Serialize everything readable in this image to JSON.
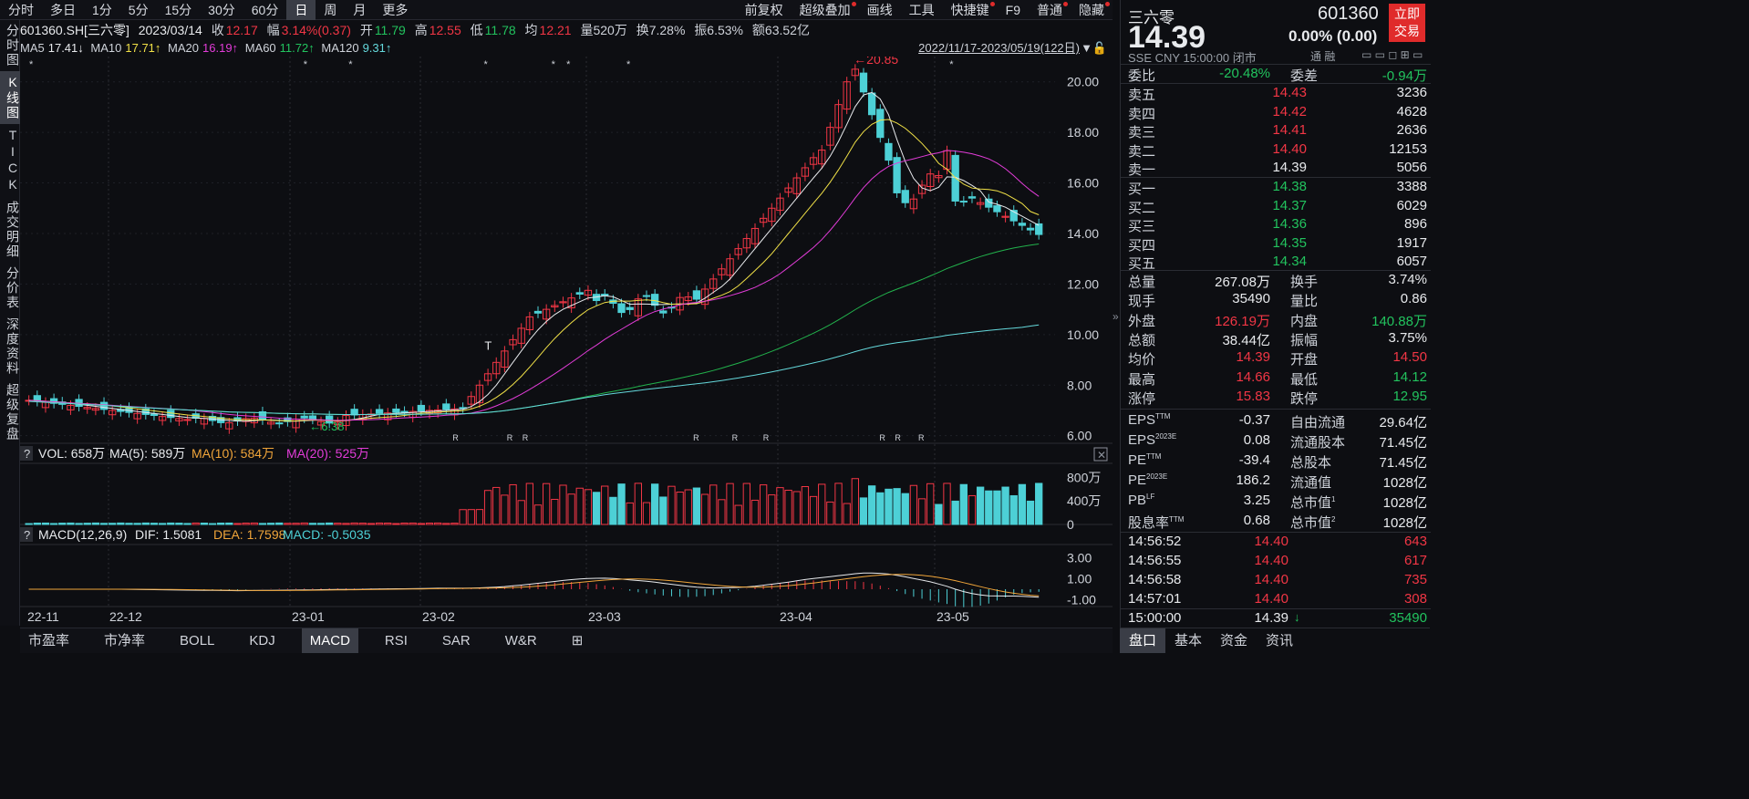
{
  "top_tabs": [
    "分时",
    "多日",
    "1分",
    "5分",
    "15分",
    "30分",
    "60分",
    "日",
    "周",
    "月",
    "更多"
  ],
  "active_tab": "日",
  "top_tools": [
    {
      "label": "前复权",
      "dot": false
    },
    {
      "label": "超级叠加",
      "dot": true
    },
    {
      "label": "画线",
      "dot": false
    },
    {
      "label": "工具",
      "dot": false
    },
    {
      "label": "快捷键",
      "dot": true
    },
    {
      "label": "F9",
      "dot": false
    },
    {
      "label": "普通",
      "dot": true
    },
    {
      "label": "隐藏",
      "dot": true
    }
  ],
  "left_nav": [
    "分时图",
    "K线图",
    "TICK",
    "成交明细",
    "分价表",
    "深度资料",
    "超级复盘"
  ],
  "info": {
    "code": "601360.SH[三六零]",
    "date": "2023/03/14",
    "close_label": "收",
    "close": "12.17",
    "chg_label": "幅",
    "chg": "3.14%(0.37)",
    "open_label": "开",
    "open": "11.79",
    "high_label": "高",
    "high": "12.55",
    "low_label": "低",
    "low": "11.78",
    "avg_label": "均",
    "avg": "12.21",
    "vol": "量520万",
    "turnover": "换7.28%",
    "amp": "振6.53%",
    "amount": "额63.52亿"
  },
  "ma": {
    "ma5": "MA5",
    "ma5v": "17.41↓",
    "ma10": "MA10",
    "ma10v": "17.71↑",
    "ma20": "MA20",
    "ma20v": "16.19↑",
    "ma60": "MA60",
    "ma60v": "11.72↑",
    "ma120": "MA120",
    "ma120v": "9.31↑"
  },
  "date_range": "2022/11/17-2023/05/19(122日)",
  "kline": {
    "y_ticks": [
      "20.00",
      "18.00",
      "16.00",
      "14.00",
      "12.00",
      "10.00",
      "8.00",
      "6.00"
    ],
    "max_label": "←20.85",
    "min_label": "←6.38",
    "t_label": "T",
    "star": "*",
    "r_label": "R",
    "x_labels": [
      "22-11",
      "22-12",
      "23-01",
      "23-02",
      "23-03",
      "23-04",
      "23-05"
    ]
  },
  "vol": {
    "q": "?",
    "label": "VOL: 658万",
    "ma5": "MA(5): 589万",
    "ma10": "MA(10): 584万",
    "ma20": "MA(20): 525万",
    "ticks": [
      "800万",
      "400万",
      "0"
    ]
  },
  "macd": {
    "q": "?",
    "label": "MACD(12,26,9)",
    "dif": "DIF: 1.5081",
    "dea": "DEA: 1.7598",
    "macd": "MACD: -0.5035",
    "ticks": [
      "3.00",
      "1.00",
      "-1.00"
    ]
  },
  "bottom_tabs": [
    "市盈率",
    "市净率",
    "BOLL",
    "KDJ",
    "MACD",
    "RSI",
    "SAR",
    "W&R"
  ],
  "bottom_active": "MACD",
  "stock": {
    "name": "三六零",
    "code": "601360",
    "price": "14.39",
    "change": "0.00% (0.00)",
    "exchange": "SSE",
    "currency": "CNY",
    "time": "15:00:00",
    "status": "闭市",
    "trade_btn": "立即交易",
    "tags": "通 融"
  },
  "weibi": {
    "l1": "委比",
    "v1": "-20.48%",
    "l2": "委差",
    "v2": "-0.94万"
  },
  "asks": [
    {
      "label": "卖五",
      "price": "14.43",
      "vol": "3236"
    },
    {
      "label": "卖四",
      "price": "14.42",
      "vol": "4628"
    },
    {
      "label": "卖三",
      "price": "14.41",
      "vol": "2636"
    },
    {
      "label": "卖二",
      "price": "14.40",
      "vol": "12153"
    },
    {
      "label": "卖一",
      "price": "14.39",
      "vol": "5056"
    }
  ],
  "bids": [
    {
      "label": "买一",
      "price": "14.38",
      "vol": "3388"
    },
    {
      "label": "买二",
      "price": "14.37",
      "vol": "6029"
    },
    {
      "label": "买三",
      "price": "14.36",
      "vol": "896"
    },
    {
      "label": "买四",
      "price": "14.35",
      "vol": "1917"
    },
    {
      "label": "买五",
      "price": "14.34",
      "vol": "6057"
    }
  ],
  "stats": [
    {
      "l": "总量",
      "v": "267.08万",
      "l2": "换手",
      "v2": "3.74%"
    },
    {
      "l": "现手",
      "v": "35490",
      "l2": "量比",
      "v2": "0.86"
    },
    {
      "l": "外盘",
      "v": "126.19万",
      "l2": "内盘",
      "v2": "140.88万"
    },
    {
      "l": "总额",
      "v": "38.44亿",
      "l2": "振幅",
      "v2": "3.75%"
    },
    {
      "l": "均价",
      "v": "14.39",
      "l2": "开盘",
      "v2": "14.50"
    },
    {
      "l": "最高",
      "v": "14.66",
      "l2": "最低",
      "v2": "14.12"
    },
    {
      "l": "涨停",
      "v": "15.83",
      "l2": "跌停",
      "v2": "12.95"
    }
  ],
  "fund": [
    {
      "l": "EPS",
      "sup": "TTM",
      "v": "-0.37",
      "l2": "自由流通",
      "v2": "29.64亿"
    },
    {
      "l": "EPS",
      "sup": "2023E",
      "v": "0.08",
      "l2": "流通股本",
      "v2": "71.45亿"
    },
    {
      "l": "PE",
      "sup": "TTM",
      "v": "-39.4",
      "l2": "总股本",
      "v2": "71.45亿"
    },
    {
      "l": "PE",
      "sup": "2023E",
      "v": "186.2",
      "l2": "流通值",
      "v2": "1028亿"
    },
    {
      "l": "PB",
      "sup": "LF",
      "v": "3.25",
      "l2": "总市值",
      "sup2": "1",
      "v2": "1028亿"
    },
    {
      "l": "股息率",
      "sup": "TTM",
      "v": "0.68",
      "l2": "总市值",
      "sup2": "2",
      "v2": "1028亿"
    }
  ],
  "ticks": [
    {
      "t": "14:56:52",
      "p": "14.40",
      "v": "643"
    },
    {
      "t": "14:56:55",
      "p": "14.40",
      "v": "617"
    },
    {
      "t": "14:56:58",
      "p": "14.40",
      "v": "735"
    },
    {
      "t": "14:57:01",
      "p": "14.40",
      "v": "308"
    },
    {
      "t": "15:00:00",
      "p": "14.39",
      "arrow": "↓",
      "v": "35490"
    }
  ],
  "right_tabs": [
    "盘口",
    "基本",
    "资金",
    "资讯"
  ],
  "right_active": "盘口",
  "collapse_arrow": "»",
  "colors": {
    "up": "#f23645",
    "down": "#22c35e",
    "bear_bar": "#4dd0d6",
    "ma5": "#e8eaed",
    "ma10": "#f0e047",
    "ma20": "#e23cd8",
    "ma60": "#22b24c",
    "ma120": "#65d9dc"
  }
}
